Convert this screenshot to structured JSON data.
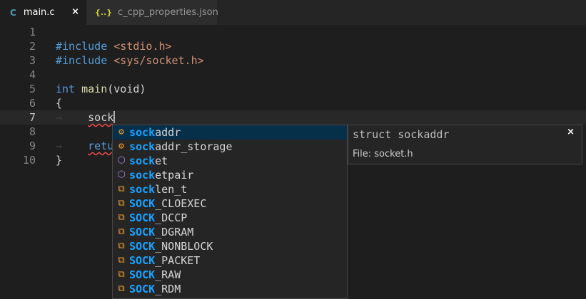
{
  "tabs": [
    {
      "label": "main.c",
      "icon": "C",
      "close": "×"
    },
    {
      "label": "c_cpp_properties.json",
      "icon": "{..}"
    }
  ],
  "editor": {
    "lines": [
      {
        "n": "1"
      },
      {
        "n": "2"
      },
      {
        "n": "3"
      },
      {
        "n": "4"
      },
      {
        "n": "5"
      },
      {
        "n": "6"
      },
      {
        "n": "7"
      },
      {
        "n": "8"
      },
      {
        "n": "9"
      },
      {
        "n": "10"
      }
    ],
    "include_kw": "#include",
    "include1": "<stdio.h>",
    "include2": "<sys/socket.h>",
    "int_kw": "int",
    "main_fn": "main",
    "main_params": "(void)",
    "open_brace": "{",
    "typed": "sock",
    "return_partial": "retu",
    "close_brace": "}",
    "tab_arrow": "→"
  },
  "suggestions": {
    "items": [
      {
        "match": "sock",
        "rest": "addr",
        "kind": "struct"
      },
      {
        "match": "sock",
        "rest": "addr_storage",
        "kind": "struct"
      },
      {
        "match": "sock",
        "rest": "et",
        "kind": "function"
      },
      {
        "match": "sock",
        "rest": "etpair",
        "kind": "function"
      },
      {
        "match": "sock",
        "rest": "len_t",
        "kind": "typedef"
      },
      {
        "match": "SOCK",
        "rest": "_CLOEXEC",
        "kind": "macro"
      },
      {
        "match": "SOCK",
        "rest": "_DCCP",
        "kind": "macro"
      },
      {
        "match": "SOCK",
        "rest": "_DGRAM",
        "kind": "macro"
      },
      {
        "match": "SOCK",
        "rest": "_NONBLOCK",
        "kind": "macro"
      },
      {
        "match": "SOCK",
        "rest": "_PACKET",
        "kind": "macro"
      },
      {
        "match": "SOCK",
        "rest": "_RAW",
        "kind": "macro"
      },
      {
        "match": "SOCK",
        "rest": "_RDM",
        "kind": "macro"
      }
    ]
  },
  "details": {
    "signature": "struct sockaddr",
    "file": "File: socket.h",
    "close": "×"
  },
  "colors": {
    "match_highlight": "#18a3ff",
    "selection": "#062f4a",
    "background": "#1e1e1e"
  }
}
